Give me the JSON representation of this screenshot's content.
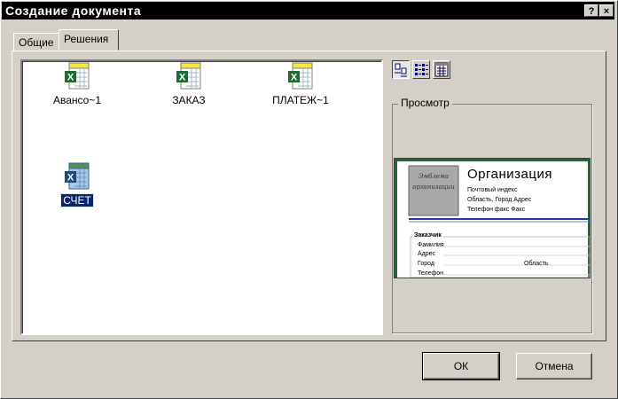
{
  "window": {
    "title": "Создание документа",
    "help_button": "?",
    "close_button": "×"
  },
  "tabs": [
    {
      "label": "Общие",
      "active": false
    },
    {
      "label": "Решения",
      "active": true
    }
  ],
  "files": [
    {
      "name": "Авансо~1",
      "icon": "excel-template-icon",
      "selected": false
    },
    {
      "name": "ЗАКАЗ",
      "icon": "excel-template-icon",
      "selected": false
    },
    {
      "name": "ПЛАТЕЖ~1",
      "icon": "excel-template-icon",
      "selected": false
    },
    {
      "name": "СЧЕТ",
      "icon": "excel-workbook-icon",
      "selected": true
    }
  ],
  "view_buttons": [
    {
      "icon": "large-icons-view-icon",
      "pressed": true
    },
    {
      "icon": "list-view-icon",
      "pressed": false
    },
    {
      "icon": "details-view-icon",
      "pressed": false
    }
  ],
  "preview": {
    "label": "Просмотр",
    "logo_text": "Эмблема организации",
    "org_title": "Организация",
    "line1": "Почтовый индекс",
    "line2": "Область, Город  Адрес",
    "line3": "Телефон факс Факс",
    "section": "Заказчик",
    "field_name": "Фамилия",
    "field_address": "Адрес",
    "field_city": "Город",
    "field_region": "Область",
    "field_phone": "Телефон"
  },
  "buttons": {
    "ok": "ОК",
    "cancel": "Отмена"
  },
  "colors": {
    "titlebar": "#000000",
    "selection": "#0a246a",
    "excel_green": "#1e6b2f",
    "preview_accent_blue": "#1b3fa0"
  }
}
